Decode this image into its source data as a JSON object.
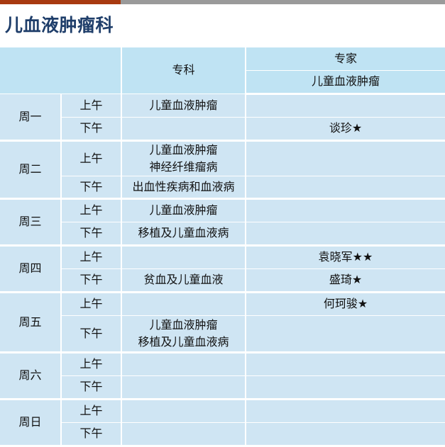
{
  "page": {
    "title": "儿血液肿瘤科"
  },
  "header": {
    "specialty": "专科",
    "expert": "专家",
    "expert_sub": "儿童血液肿瘤"
  },
  "colors": {
    "accent": "#a83a10",
    "title": "#1f3e6a",
    "header_bg": "#bfe3f3",
    "cell_bg": "#cfe5f3"
  },
  "schedule": [
    {
      "day": "周一",
      "am": {
        "period": "上午",
        "specialty": [
          "儿童血液肿瘤"
        ],
        "expert": ""
      },
      "pm": {
        "period": "下午",
        "specialty": [],
        "expert": "谈珍★"
      }
    },
    {
      "day": "周二",
      "am": {
        "period": "上午",
        "specialty": [
          "儿童血液肿瘤",
          "神经纤维瘤病"
        ],
        "expert": ""
      },
      "pm": {
        "period": "下午",
        "specialty": [
          "出血性疾病和血液病"
        ],
        "expert": ""
      }
    },
    {
      "day": "周三",
      "am": {
        "period": "上午",
        "specialty": [
          "儿童血液肿瘤"
        ],
        "expert": ""
      },
      "pm": {
        "period": "下午",
        "specialty": [
          "移植及儿童血液病"
        ],
        "expert": ""
      }
    },
    {
      "day": "周四",
      "am": {
        "period": "上午",
        "specialty": [],
        "expert": "袁晓军★★"
      },
      "pm": {
        "period": "下午",
        "specialty": [
          "贫血及儿童血液"
        ],
        "expert": "盛琦★"
      }
    },
    {
      "day": "周五",
      "am": {
        "period": "上午",
        "specialty": [],
        "expert": "何珂骏★"
      },
      "pm": {
        "period": "下午",
        "specialty": [
          "儿童血液肿瘤",
          "移植及儿童血液病"
        ],
        "expert": ""
      }
    },
    {
      "day": "周六",
      "am": {
        "period": "上午",
        "specialty": [],
        "expert": ""
      },
      "pm": {
        "period": "下午",
        "specialty": [],
        "expert": ""
      }
    },
    {
      "day": "周日",
      "am": {
        "period": "上午",
        "specialty": [],
        "expert": ""
      },
      "pm": {
        "period": "下午",
        "specialty": [],
        "expert": ""
      }
    }
  ]
}
